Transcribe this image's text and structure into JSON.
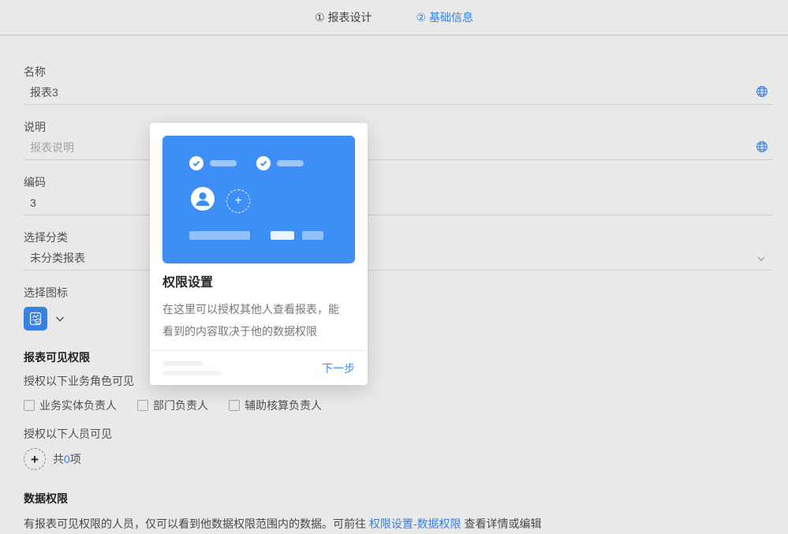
{
  "header": {
    "step1": "① 报表设计",
    "step2": "② 基础信息"
  },
  "form": {
    "name_label": "名称",
    "name_value": "报表3",
    "desc_label": "说明",
    "desc_placeholder": "报表说明",
    "code_label": "编码",
    "code_value": "3",
    "category_label": "选择分类",
    "category_value": "未分类报表",
    "icon_label": "选择图标",
    "visibility_title": "报表可见权限",
    "role_hint": "授权以下业务角色可见",
    "roles": [
      "业务实体负责人",
      "部门负责人",
      "辅助核算负责人"
    ],
    "people_hint": "授权以下人员可见",
    "add_button_glyph": "+",
    "count_prefix": "共",
    "count_value": "0",
    "count_suffix": "项"
  },
  "data_permission": {
    "title": "数据权限",
    "text_before": "有报表可见权限的人员，仅可以看到他数据权限范围内的数据。可前往 ",
    "link_text": "权限设置-数据权限",
    "text_after": " 查看详情或编辑"
  },
  "tour_popup": {
    "title": "权限设置",
    "description": "在这里可以授权其他人查看报表，能\n看到的内容取决于他的数据权限",
    "next_button": "下一步",
    "plus_glyph": "+"
  },
  "icons": {
    "globe": "translate-globe",
    "chevron": "chevron-down",
    "report_icon": "report-with-check",
    "add": "plus-in-dashed-circle"
  },
  "colors": {
    "accent_blue": "#3e8ef7",
    "mask": "rgba(0,0,0,0.085)",
    "label_gray": "#595959",
    "title_dark": "#262626"
  }
}
